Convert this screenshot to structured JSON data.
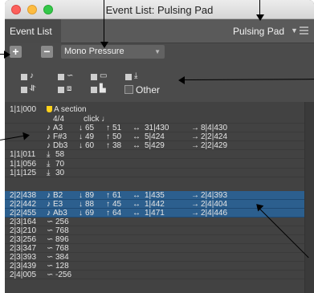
{
  "window": {
    "title": "Event List: Pulsing Pad"
  },
  "header": {
    "tab_label": "Event List",
    "track_name": "Pulsing Pad",
    "track_arrow": "▼",
    "menu_icon": "hamburger-menu-icon"
  },
  "controls": {
    "plus_label": "+",
    "minus_label": "−",
    "mode_value": "Mono Pressure",
    "mode_arrow": "▼",
    "filters": [
      {
        "icon": "note-icon",
        "glyph": "♪"
      },
      {
        "icon": "pitchbend-icon",
        "glyph": "∽"
      },
      {
        "icon": "program-icon",
        "glyph": "▭"
      },
      {
        "icon": "pressure-icon",
        "glyph": "⤓"
      },
      {
        "icon": "poly-pressure-icon",
        "glyph": "⥯"
      },
      {
        "icon": "control-change-icon",
        "glyph": "⧈"
      },
      {
        "icon": "system-exclusive-icon",
        "glyph": "▙"
      }
    ],
    "other_label": "Other"
  },
  "events": [
    {
      "pos": "1|1|000",
      "text": "A section",
      "type": "marker"
    },
    {
      "pos": "",
      "text": "4/4",
      "extra": "click ♩",
      "type": "meter"
    },
    {
      "pos": "",
      "note": "A3",
      "vel": "65",
      "rel": "51",
      "len": "31|430",
      "end": "8|4|430",
      "type": "note"
    },
    {
      "pos": "",
      "note": "F#3",
      "vel": "49",
      "rel": "50",
      "len": "5|424",
      "end": "2|2|424",
      "type": "note"
    },
    {
      "pos": "",
      "note": "Db3",
      "vel": "60",
      "rel": "38",
      "len": "5|429",
      "end": "2|2|429",
      "type": "note"
    },
    {
      "pos": "1|1|011",
      "val": "58",
      "type": "pressure"
    },
    {
      "pos": "1|1|056",
      "val": "70",
      "type": "pressure"
    },
    {
      "pos": "1|1|125",
      "val": "30",
      "type": "pressure"
    },
    {
      "pos": "2|2|438",
      "note": "B2",
      "vel": "89",
      "rel": "61",
      "len": "1|435",
      "end": "2|4|393",
      "type": "note",
      "selected": true
    },
    {
      "pos": "2|2|442",
      "note": "E3",
      "vel": "88",
      "rel": "45",
      "len": "1|442",
      "end": "2|4|404",
      "type": "note",
      "selected": true
    },
    {
      "pos": "2|2|455",
      "note": "Ab3",
      "vel": "69",
      "rel": "64",
      "len": "1|471",
      "end": "2|4|446",
      "type": "note",
      "selected": true
    },
    {
      "pos": "2|3|164",
      "val": "256",
      "type": "bend"
    },
    {
      "pos": "2|3|210",
      "val": "768",
      "type": "bend"
    },
    {
      "pos": "2|3|256",
      "val": "896",
      "type": "bend"
    },
    {
      "pos": "2|3|347",
      "val": "768",
      "type": "bend"
    },
    {
      "pos": "2|3|393",
      "val": "384",
      "type": "bend"
    },
    {
      "pos": "2|3|439",
      "val": "128",
      "type": "bend"
    },
    {
      "pos": "2|4|005",
      "val": "-256",
      "type": "bend"
    }
  ]
}
